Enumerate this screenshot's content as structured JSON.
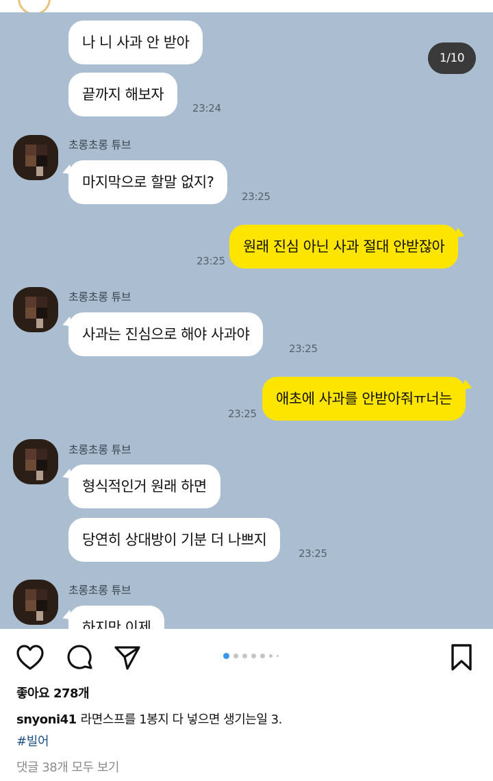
{
  "image_counter": "1/10",
  "chat": {
    "sender_name": "초롱초롱 튜브",
    "messages": [
      {
        "text": "나 니 사과 안 받아"
      },
      {
        "text": "끝까지 해보자",
        "time": "23:24"
      },
      {
        "text": "마지막으로 할말 없지?",
        "time": "23:25"
      },
      {
        "text": "원래 진심 아닌 사과 절대 안받잖아",
        "time": "23:25"
      },
      {
        "text": "사과는 진심으로 해야 사과야",
        "time": "23:25"
      },
      {
        "text": "애초에 사과를 안받아줘ㅠ너는",
        "time": "23:25"
      },
      {
        "text": "형식적인거 원래 하면"
      },
      {
        "text": "당연히 상대방이 기분 더 나쁘지",
        "time": "23:25"
      },
      {
        "text": "하지만 이제"
      }
    ]
  },
  "actions": {
    "like_icon": "heart-icon",
    "comment_icon": "comment-icon",
    "share_icon": "send-icon",
    "save_icon": "bookmark-icon"
  },
  "carousel": {
    "active_index": 1,
    "accent": "#3897f0"
  },
  "post": {
    "likes": "좋아요 278개",
    "username": "snyoni41",
    "caption": "라면스프를 1봉지 다 넣으면 생기는일 3.",
    "hashtag": "#빌어",
    "comments_link": "댓글 38개 모두 보기"
  },
  "colors": {
    "chat_background": "#abbdd1",
    "outgoing_bubble": "#fee500",
    "incoming_bubble": "#ffffff"
  }
}
